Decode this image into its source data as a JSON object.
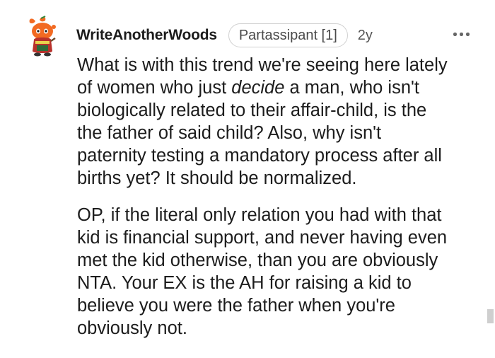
{
  "comment": {
    "author": "WriteAnotherWoods",
    "flair": "Partassipant [1]",
    "age": "2y",
    "more_icon": "ellipsis-icon",
    "avatar_icon": "snoo-avatar-icon",
    "paragraph1_line1": "What is with this trend we're seeing here lately",
    "paragraph1_line2_before": "of women who just ",
    "paragraph1_line2_emphasis": "decide",
    "paragraph1_line2_after": " a man, who isn't",
    "paragraph1_line3": "biologically related to their affair-child, is the",
    "paragraph1_line4": "the father of said child? Also, why isn't",
    "paragraph1_line5": "paternity testing a mandatory process after all",
    "paragraph1_line6": "births yet? It should be normalized.",
    "paragraph2": "OP, if the literal only relation you had with that\nkid is financial support, and never having even\nmet the kid otherwise, than you are obviously\nNTA. Your EX is the AH for raising a kid to\nbelieve you were the father when you're\nobviously not."
  },
  "colors": {
    "text": "#1c1c1c",
    "meta": "#555555",
    "flair_border": "#d0d0d0",
    "avatar_orange": "#f26a22"
  }
}
